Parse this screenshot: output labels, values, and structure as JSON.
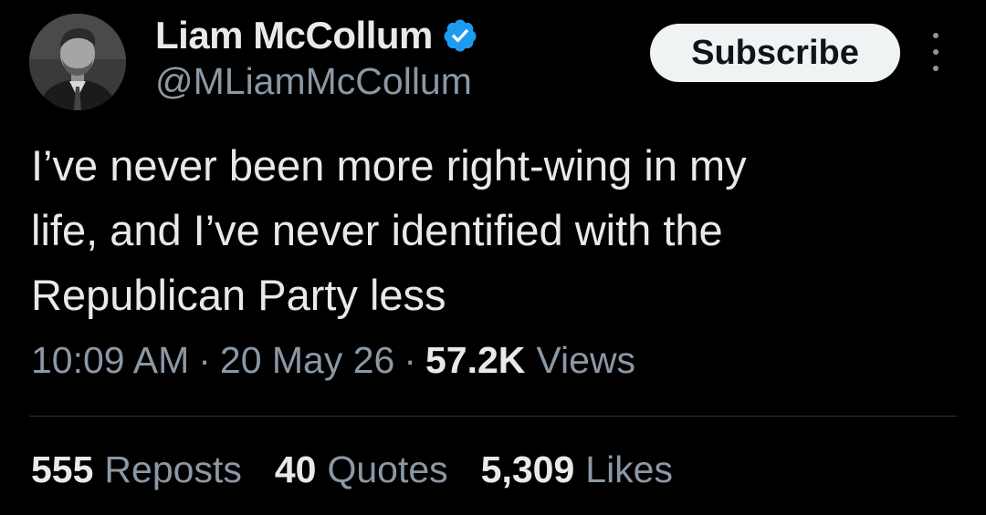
{
  "user": {
    "display_name": "Liam McCollum",
    "handle": "@MLiamMcCollum",
    "verified": true,
    "verified_color": "#1d9bf0"
  },
  "header": {
    "subscribe_label": "Subscribe"
  },
  "tweet": {
    "text": "I’ve never been more right-wing in my\nlife, and I’ve never identified with the\nRepublican Party less"
  },
  "meta": {
    "time": "10:09 AM",
    "separator": "·",
    "date": "20 May 26",
    "views_count": "57.2K",
    "views_label": "Views"
  },
  "stats": {
    "reposts_count": "555",
    "reposts_label": "Reposts",
    "quotes_count": "40",
    "quotes_label": "Quotes",
    "likes_count": "5,309",
    "likes_label": "Likes"
  },
  "icons": {
    "verified": "verified-badge-icon",
    "more": "more-options-icon"
  },
  "colors": {
    "background": "#000000",
    "primary_text": "#e7e9ea",
    "secondary_text": "#8b98a5",
    "button_bg": "#eff3f4",
    "button_text": "#0f1419",
    "divider": "#2f3336"
  }
}
